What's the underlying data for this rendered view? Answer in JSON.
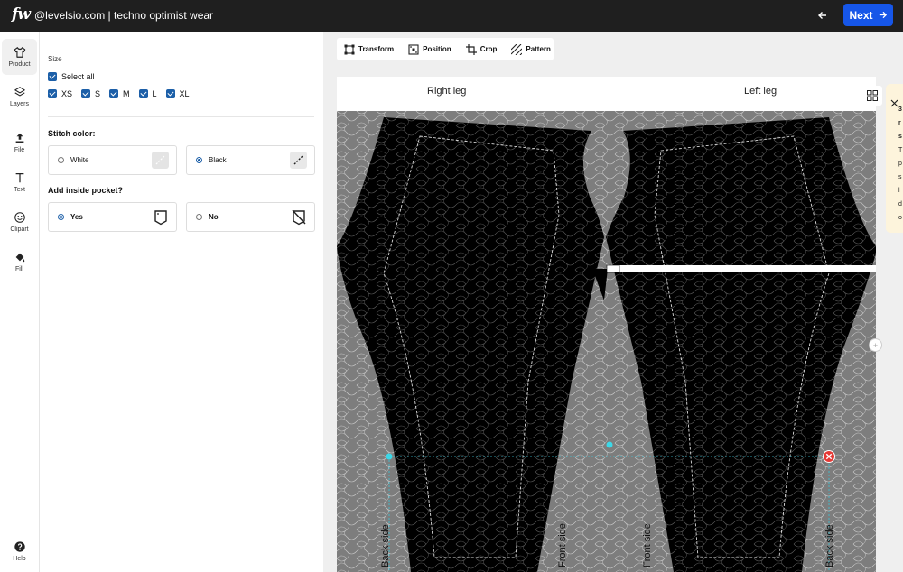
{
  "topbar": {
    "logo": "fw",
    "title": "@levelsio.com | techno optimist wear",
    "next_label": "Next"
  },
  "rail": {
    "items": [
      {
        "label": "Product",
        "icon": "shirt-icon"
      },
      {
        "label": "Layers",
        "icon": "layers-icon"
      },
      {
        "label": "File",
        "icon": "upload-icon"
      },
      {
        "label": "Text",
        "icon": "text-icon"
      },
      {
        "label": "Clipart",
        "icon": "smiley-icon"
      },
      {
        "label": "Fill",
        "icon": "paint-bucket-icon"
      }
    ],
    "help_label": "Help"
  },
  "panel": {
    "size_label": "Size",
    "select_all_label": "Select all",
    "sizes": [
      "XS",
      "S",
      "M",
      "L",
      "XL"
    ],
    "stitch_label": "Stitch color:",
    "stitch_options": [
      {
        "label": "White",
        "selected": false
      },
      {
        "label": "Black",
        "selected": true
      }
    ],
    "pocket_label": "Add inside pocket?",
    "pocket_options": [
      {
        "label": "Yes",
        "selected": true
      },
      {
        "label": "No",
        "selected": false
      }
    ]
  },
  "toolbar": {
    "transform_label": "Transform",
    "position_label": "Position",
    "crop_label": "Crop",
    "pattern_label": "Pattern"
  },
  "artboard": {
    "right_leg_label": "Right leg",
    "left_leg_label": "Left leg",
    "side_labels": [
      "Back side",
      "Front side",
      "Front side",
      "Back side"
    ]
  },
  "tip": {
    "visible_lines": [
      "3",
      "r",
      "s",
      "T",
      "p",
      "s",
      "l",
      "d",
      "o"
    ]
  },
  "colors": {
    "accent": "#1656e8",
    "checkbox": "#1c5fa8",
    "topbar": "#1f1f1f",
    "selection_guide": "#3cc4d8",
    "delete_handle": "#e53935"
  }
}
